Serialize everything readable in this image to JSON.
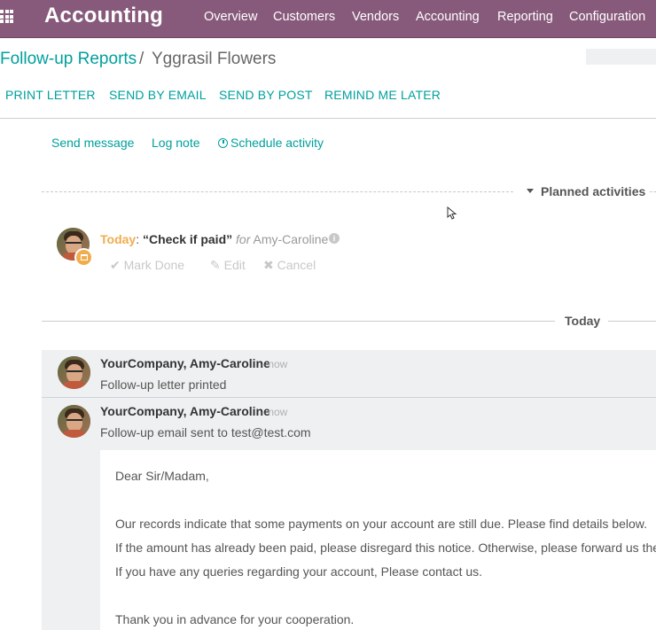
{
  "navbar": {
    "brand": "Accounting",
    "menu": [
      "Overview",
      "Customers",
      "Vendors",
      "Accounting",
      "Reporting",
      "Configuration"
    ],
    "color": "#875a7b"
  },
  "breadcrumb": {
    "parent": "Follow-up Reports",
    "separator": "/",
    "current": "Yggrasil Flowers"
  },
  "actions": [
    "PRINT LETTER",
    "SEND BY EMAIL",
    "SEND BY POST",
    "REMIND ME LATER"
  ],
  "chatter": {
    "send_message": "Send message",
    "log_note": "Log note",
    "schedule_activity": "Schedule activity"
  },
  "planned": {
    "label": "Planned activities",
    "activity": {
      "when": "Today",
      "colon": ":",
      "summary": "“Check if paid”",
      "for_word": "for",
      "user": "Amy-Caroline",
      "mark_done": "Mark Done",
      "edit": "Edit",
      "cancel": "Cancel"
    }
  },
  "separator": {
    "label": "Today"
  },
  "messages": [
    {
      "author": "YourCompany, Amy-Caroline",
      "date": "- now",
      "body": "Follow-up letter printed"
    },
    {
      "author": "YourCompany, Amy-Caroline",
      "date": "- now",
      "body": "Follow-up email sent to test@test.com",
      "email": {
        "greeting": "Dear Sir/Madam,",
        "lines": [
          "Our records indicate that some payments on your account are still due. Please find details below.",
          "If the amount has already been paid, please disregard this notice. Otherwise, please forward us the t",
          "If you have any queries regarding your account, Please contact us.",
          "Thank you in advance for your cooperation."
        ]
      }
    }
  ],
  "colors": {
    "accent": "#00a09d",
    "today": "#f0ad4e"
  }
}
